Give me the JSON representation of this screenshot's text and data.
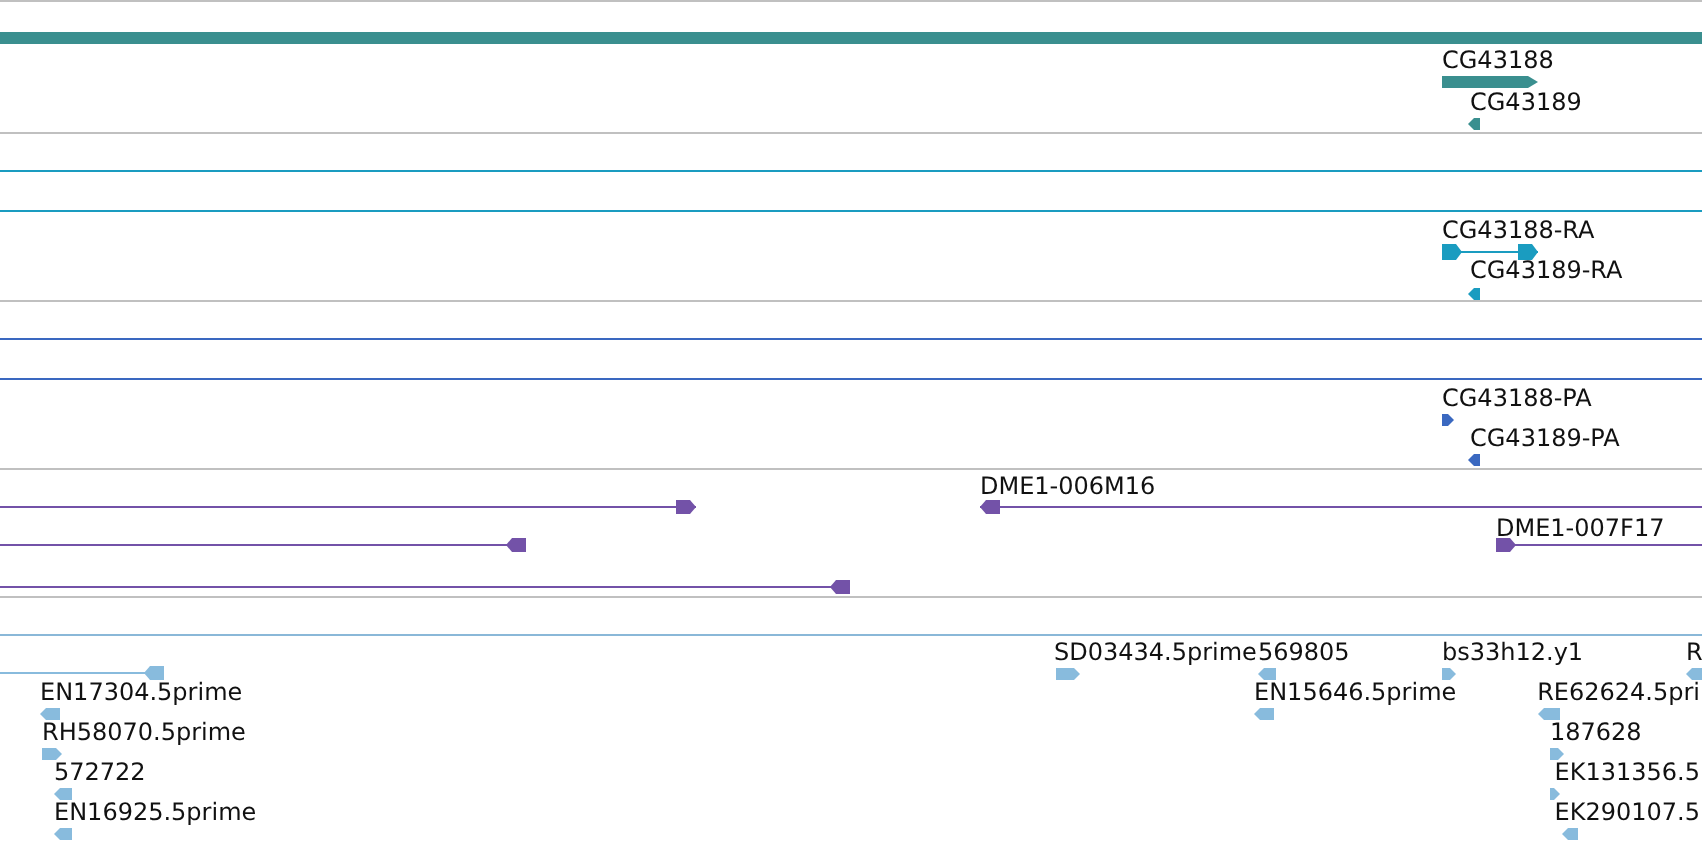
{
  "tracks": [
    {
      "kind": "gene",
      "color": "#3a8f8f",
      "features": [
        {
          "label": "CG43188",
          "reverse": false
        },
        {
          "label": "CG43189",
          "reverse": true
        }
      ]
    },
    {
      "kind": "transcript",
      "color": "#1a9cc0",
      "features": [
        {
          "label": "CG43188-RA",
          "reverse": false
        },
        {
          "label": "CG43189-RA",
          "reverse": true
        }
      ]
    },
    {
      "kind": "protein",
      "color": "#3a68c0",
      "features": [
        {
          "label": "CG43188-PA",
          "reverse": false
        },
        {
          "label": "CG43189-PA",
          "reverse": true
        }
      ]
    },
    {
      "kind": "clone",
      "color": "#7352a8",
      "features": [
        {
          "reverse": false
        },
        {
          "label": "DME1-006M16",
          "reverse": true
        },
        {
          "reverse": true
        },
        {
          "label": "DME1-007F17",
          "reverse": false
        },
        {
          "reverse": true
        }
      ]
    },
    {
      "kind": "est",
      "color": "#88bbdd",
      "features": [
        {
          "reverse": true
        },
        {
          "label": "EN17304.5prime",
          "reverse": true
        },
        {
          "label": "RH58070.5prime",
          "reverse": false
        },
        {
          "label": "572722",
          "reverse": true
        },
        {
          "label": "EN16925.5prime",
          "reverse": true
        },
        {
          "label": "SD03434.5prime",
          "reverse": false
        },
        {
          "label": "569805",
          "reverse": true
        },
        {
          "label": "EN15646.5prime",
          "reverse": true
        },
        {
          "label": "bs33h12.y1",
          "reverse": false
        },
        {
          "label": "R",
          "reverse": true
        },
        {
          "label": "RE62624.5pri",
          "reverse": true
        },
        {
          "label": "187628",
          "reverse": false
        },
        {
          "label": "EK131356.5",
          "reverse": false
        },
        {
          "label": "EK290107.5",
          "reverse": true
        }
      ]
    }
  ]
}
